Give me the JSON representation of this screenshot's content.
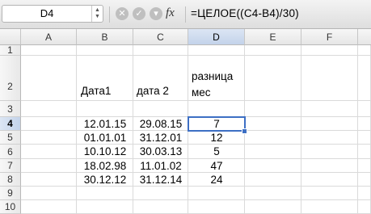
{
  "formula_bar": {
    "name_box": "D4",
    "fx_label": "fx",
    "formula": "=ЦЕЛОЕ((C4-B4)/30)"
  },
  "columns": [
    "A",
    "B",
    "C",
    "D",
    "E",
    "F"
  ],
  "rows": [
    "1",
    "2",
    "3",
    "4",
    "5",
    "6",
    "7",
    "8",
    "9",
    "10"
  ],
  "headers": {
    "b2": "Дата1",
    "c2": "дата 2",
    "d2_line1": "разница",
    "d2_line2": "мес"
  },
  "data_rows": [
    {
      "b": "12.01.15",
      "c": "29.08.15",
      "d": "7"
    },
    {
      "b": "01.01.01",
      "c": "31.12.01",
      "d": "12"
    },
    {
      "b": "10.10.12",
      "c": "30.03.13",
      "d": "5"
    },
    {
      "b": "18.02.98",
      "c": "11.01.02",
      "d": "47"
    },
    {
      "b": "30.12.12",
      "c": "31.12.14",
      "d": "24"
    }
  ],
  "icons": [
    "chevron-updown-icon",
    "cancel-icon",
    "confirm-icon",
    "dropdown-icon",
    "fx-icon"
  ]
}
